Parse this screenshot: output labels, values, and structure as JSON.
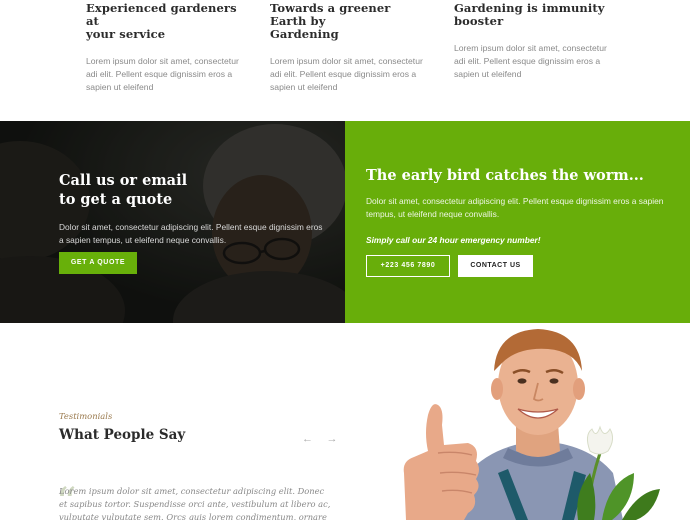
{
  "features": [
    {
      "title_line1": "Experienced gardeners at",
      "title_line2": "your service",
      "text": "Lorem ipsum dolor sit amet, consectetur adi elit. Pellent esque dignissim eros a sapien ut eleifend"
    },
    {
      "title_line1": "Towards a greener Earth by",
      "title_line2": "Gardening",
      "text": "Lorem ipsum dolor sit amet, consectetur adi elit. Pellent esque dignissim eros a sapien ut eleifend"
    },
    {
      "title_line1": "Gardening is immunity",
      "title_line2": "booster",
      "text": "Lorem ipsum dolor sit amet, consectetur adi elit. Pellent esque dignissim eros a sapien ut eleifend"
    }
  ],
  "quote_panel": {
    "title_line1": "Call us or email",
    "title_line2": "to get a quote",
    "text": "Dolor sit amet, consectetur adipiscing elit. Pellent esque dignissim eros a sapien tempus, ut eleifend neque convallis.",
    "button": "GET A QUOTE"
  },
  "contact_panel": {
    "title": "The early bird catches the worm...",
    "text": "Dolor sit amet, consectetur adipiscing elit. Pellent esque dignissim eros a sapien tempus, ut eleifend neque convallis.",
    "emphasis": "Simply call our 24 hour emergency number!",
    "phone_button": "+223 456 7890",
    "contact_button": "CONTACT US"
  },
  "testimonials": {
    "eyebrow": "Testimonials",
    "title": "What People Say",
    "prev_arrow": "←",
    "next_arrow": "→",
    "quote_mark": "“",
    "quote": "Lorem ipsum dolor sit amet, consectetur adipiscing elit. Donec et sapibus tortor. Suspendisse orci ante, vestibulum at libero ac, vulputate vulputate sem. Orcs quis lorem condimentum, ornare mi"
  },
  "colors": {
    "accent": "#68ae0a",
    "dark_panel": "#1b1d19",
    "eyebrow": "#9a7a4e"
  }
}
